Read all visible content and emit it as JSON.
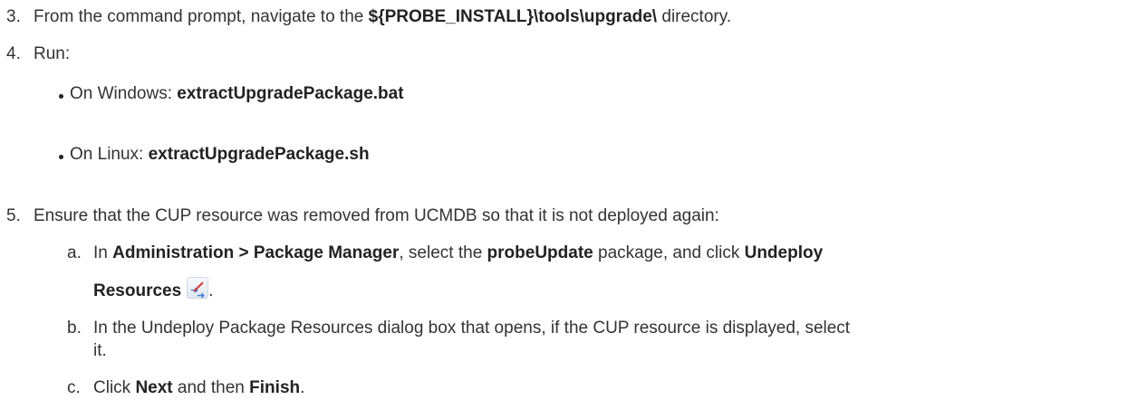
{
  "steps": {
    "s3": {
      "num": "3.",
      "pre": "From the command prompt, navigate to the ",
      "bold": "${PROBE_INSTALL}\\tools\\upgrade\\",
      "post": " directory."
    },
    "s4": {
      "num": "4.",
      "text": "Run:",
      "bullets": [
        {
          "pre": "On Windows: ",
          "bold": "extractUpgradePackage.bat"
        },
        {
          "pre": "On Linux: ",
          "bold": "extractUpgradePackage.sh"
        }
      ]
    },
    "s5": {
      "num": "5.",
      "text": "Ensure that the CUP resource was removed from UCMDB so that it is not deployed again:",
      "sub": {
        "a": {
          "num": "a.",
          "t1": "In ",
          "b1": "Administration > Package Manager",
          "t2": ", select the ",
          "b2": "probeUpdate",
          "t3": " package, and click ",
          "b3": "Undeploy",
          "b4": "Resources",
          "end": ".",
          "icon": "undeploy-resources-icon"
        },
        "b": {
          "num": "b.",
          "line1": "In the Undeploy Package Resources dialog box that opens, if the CUP resource is displayed, select",
          "line2": "it."
        },
        "c": {
          "num": "c.",
          "t1": "Click ",
          "b1": "Next",
          "t2": " and then ",
          "b2": "Finish",
          "end": "."
        }
      }
    }
  }
}
